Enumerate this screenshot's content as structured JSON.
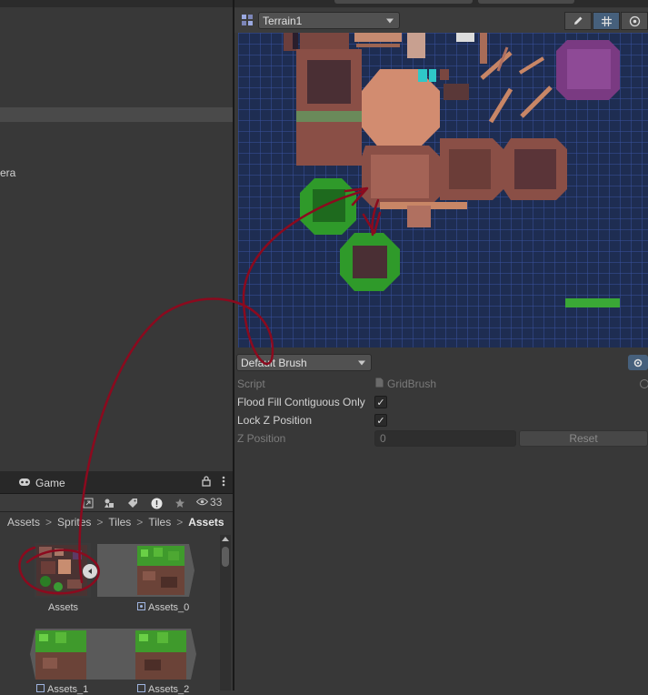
{
  "left_panel": {
    "partial_text": "era"
  },
  "game_tab": {
    "label": "Game",
    "icon": "gamepad-icon",
    "lock_icon": "lock-icon",
    "menu_icon": "kebab-menu-icon"
  },
  "project_toolbar": {
    "hidden_count": "33",
    "icons": [
      "scene-view-icon",
      "filter-by-type-icon",
      "label-icon",
      "warning-icon",
      "star-icon",
      "eye-icon"
    ]
  },
  "breadcrumb": {
    "items": [
      "Assets",
      "Sprites",
      "Tiles",
      "Tiles"
    ],
    "current": "Assets"
  },
  "assets": {
    "items": [
      {
        "label": "Assets"
      },
      {
        "label": "Assets_0"
      },
      {
        "label": "Assets_1"
      },
      {
        "label": "Assets_2"
      }
    ]
  },
  "palette": {
    "tilemap_dropdown": "Terrain1",
    "tools": [
      "pencil-icon",
      "grid-icon",
      "gizmo-icon"
    ]
  },
  "brush": {
    "dropdown": "Default Brush",
    "script_label": "Script",
    "script_value": "GridBrush",
    "flood_fill_label": "Flood Fill Contiguous Only",
    "flood_fill_checked": true,
    "lock_z_label": "Lock Z Position",
    "lock_z_checked": true,
    "z_position_label": "Z Position",
    "z_position_value": "0",
    "reset_label": "Reset",
    "checkmark": "✓"
  },
  "colors": {
    "canvas": "#1e2d52",
    "grid_line": "#3a52a0",
    "annotation": "#8b0a1e",
    "leaf_green": "#2f9a2a",
    "rock_brown": "#8a4f46"
  }
}
